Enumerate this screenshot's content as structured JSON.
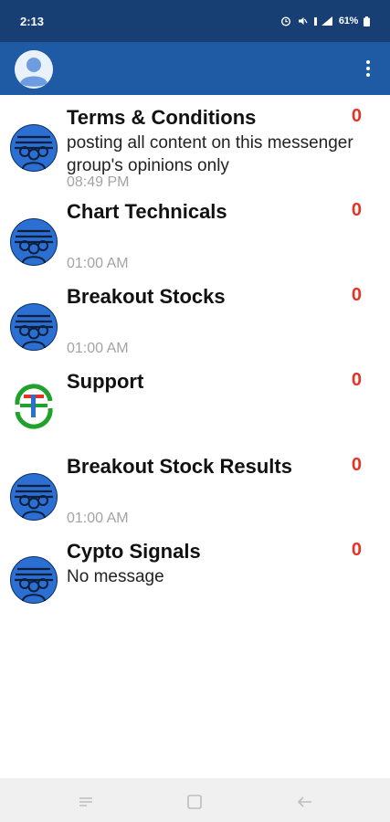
{
  "status_bar": {
    "time": "2:13",
    "battery": "61%",
    "icons": [
      "alarm-icon",
      "mute-icon",
      "signal-icon",
      "battery-icon"
    ]
  },
  "app_bar": {
    "avatar_icon": "person-icon",
    "menu_icon": "more-vert-icon"
  },
  "chats": [
    {
      "title": "Terms & Conditions",
      "preview": "posting all content on this messenger group's opinions only",
      "time": "08:49 PM",
      "count": "0",
      "avatar_icon": "group-icon"
    },
    {
      "title": "Chart Technicals",
      "preview": "",
      "time": "01:00 AM",
      "count": "0",
      "avatar_icon": "group-icon"
    },
    {
      "title": "Breakout Stocks",
      "preview": "",
      "time": "01:00 AM",
      "count": "0",
      "avatar_icon": "group-icon"
    },
    {
      "title": "Support",
      "preview": "",
      "time": "",
      "count": "0",
      "avatar_icon": "support-logo-icon"
    },
    {
      "title": "Breakout Stock Results",
      "preview": "",
      "time": "01:00 AM",
      "count": "0",
      "avatar_icon": "group-icon"
    },
    {
      "title": "Cypto Signals",
      "preview": "No message",
      "time": "",
      "count": "0",
      "avatar_icon": "group-icon"
    }
  ],
  "nav_bar": {
    "icons": [
      "recent-apps-icon",
      "home-icon",
      "back-icon"
    ]
  },
  "colors": {
    "status_bar": "#173f74",
    "app_bar": "#1f5aa5",
    "unread_count": "#e53224",
    "group_avatar": "#2a6fd1",
    "time_text": "#a3a3a3"
  }
}
